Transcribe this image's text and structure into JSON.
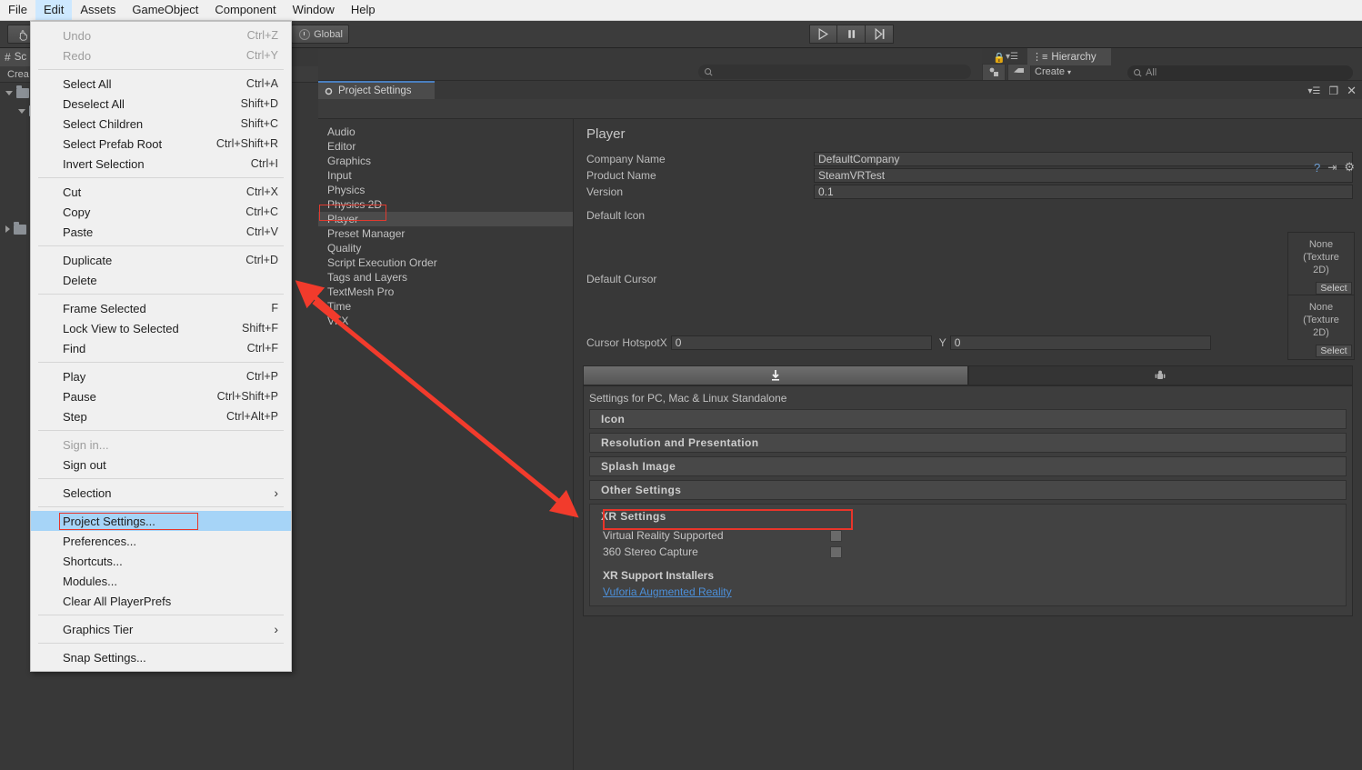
{
  "menubar": {
    "items": [
      {
        "label": "File",
        "active": false
      },
      {
        "label": "Edit",
        "active": true
      },
      {
        "label": "Assets",
        "active": false
      },
      {
        "label": "GameObject",
        "active": false
      },
      {
        "label": "Component",
        "active": false
      },
      {
        "label": "Window",
        "active": false
      },
      {
        "label": "Help",
        "active": false
      }
    ]
  },
  "edit_menu": {
    "groups": [
      [
        {
          "label": "Undo",
          "shortcut": "Ctrl+Z",
          "disabled": true
        },
        {
          "label": "Redo",
          "shortcut": "Ctrl+Y",
          "disabled": true
        }
      ],
      [
        {
          "label": "Select All",
          "shortcut": "Ctrl+A"
        },
        {
          "label": "Deselect All",
          "shortcut": "Shift+D"
        },
        {
          "label": "Select Children",
          "shortcut": "Shift+C"
        },
        {
          "label": "Select Prefab Root",
          "shortcut": "Ctrl+Shift+R"
        },
        {
          "label": "Invert Selection",
          "shortcut": "Ctrl+I"
        }
      ],
      [
        {
          "label": "Cut",
          "shortcut": "Ctrl+X"
        },
        {
          "label": "Copy",
          "shortcut": "Ctrl+C"
        },
        {
          "label": "Paste",
          "shortcut": "Ctrl+V"
        }
      ],
      [
        {
          "label": "Duplicate",
          "shortcut": "Ctrl+D"
        },
        {
          "label": "Delete",
          "shortcut": ""
        }
      ],
      [
        {
          "label": "Frame Selected",
          "shortcut": "F"
        },
        {
          "label": "Lock View to Selected",
          "shortcut": "Shift+F"
        },
        {
          "label": "Find",
          "shortcut": "Ctrl+F"
        }
      ],
      [
        {
          "label": "Play",
          "shortcut": "Ctrl+P"
        },
        {
          "label": "Pause",
          "shortcut": "Ctrl+Shift+P"
        },
        {
          "label": "Step",
          "shortcut": "Ctrl+Alt+P"
        }
      ],
      [
        {
          "label": "Sign in...",
          "shortcut": "",
          "disabled": true
        },
        {
          "label": "Sign out",
          "shortcut": ""
        }
      ],
      [
        {
          "label": "Selection",
          "shortcut": "",
          "submenu": true
        }
      ],
      [
        {
          "label": "Project Settings...",
          "shortcut": "",
          "highlighted": true
        },
        {
          "label": "Preferences...",
          "shortcut": ""
        },
        {
          "label": "Shortcuts...",
          "shortcut": ""
        },
        {
          "label": "Modules...",
          "shortcut": ""
        },
        {
          "label": "Clear All PlayerPrefs",
          "shortcut": ""
        }
      ],
      [
        {
          "label": "Graphics Tier",
          "shortcut": "",
          "submenu": true
        }
      ],
      [
        {
          "label": "Snap Settings...",
          "shortcut": ""
        }
      ]
    ]
  },
  "toolbar": {
    "hand_tool": "hand-tool",
    "global_label": "Global",
    "play_label": "play",
    "pause_label": "pause",
    "step_label": "step"
  },
  "scene_panel": {
    "tab_label": "Sc",
    "create_label": "Crea"
  },
  "hierarchy": {
    "tab_label": "Hierarchy",
    "create_label": "Create",
    "search_value": "All"
  },
  "project_settings": {
    "tab_label": "Project Settings",
    "categories": [
      {
        "label": "Audio",
        "selected": false
      },
      {
        "label": "Editor",
        "selected": false
      },
      {
        "label": "Graphics",
        "selected": false
      },
      {
        "label": "Input",
        "selected": false
      },
      {
        "label": "Physics",
        "selected": false
      },
      {
        "label": "Physics 2D",
        "selected": false
      },
      {
        "label": "Player",
        "selected": true
      },
      {
        "label": "Preset Manager",
        "selected": false
      },
      {
        "label": "Quality",
        "selected": false
      },
      {
        "label": "Script Execution Order",
        "selected": false
      },
      {
        "label": "Tags and Layers",
        "selected": false
      },
      {
        "label": "TextMesh Pro",
        "selected": false
      },
      {
        "label": "Time",
        "selected": false
      },
      {
        "label": "VFX",
        "selected": false
      }
    ]
  },
  "player": {
    "title": "Player",
    "company_name_label": "Company Name",
    "company_name_value": "DefaultCompany",
    "product_name_label": "Product Name",
    "product_name_value": "SteamVRTest",
    "version_label": "Version",
    "version_value": "0.1",
    "default_icon_label": "Default Icon",
    "default_cursor_label": "Default Cursor",
    "texture_none_line1": "None",
    "texture_none_line2": "(Texture",
    "texture_none_line3": "2D)",
    "select_label": "Select",
    "cursor_hotspot_label": "Cursor Hotspot",
    "hotspot_x_label": "X",
    "hotspot_x_value": "0",
    "hotspot_y_label": "Y",
    "hotspot_y_value": "0",
    "platform_standalone_icon": "standalone-download-icon",
    "platform_android_icon": "android-icon",
    "settings_caption": "Settings for PC, Mac & Linux Standalone",
    "sections": [
      {
        "label": "Icon"
      },
      {
        "label": "Resolution and Presentation"
      },
      {
        "label": "Splash Image"
      },
      {
        "label": "Other Settings"
      }
    ],
    "xr": {
      "title": "XR Settings",
      "virtual_reality_supported_label": "Virtual Reality Supported",
      "virtual_reality_supported_checked": false,
      "stereo_capture_label": "360 Stereo Capture",
      "stereo_capture_checked": false,
      "installers_title": "XR Support Installers",
      "installer_link": "Vuforia Augmented Reality"
    }
  },
  "annotations": {
    "accent_color": "#e8352a",
    "highlight_color": "#a6d4f7"
  }
}
